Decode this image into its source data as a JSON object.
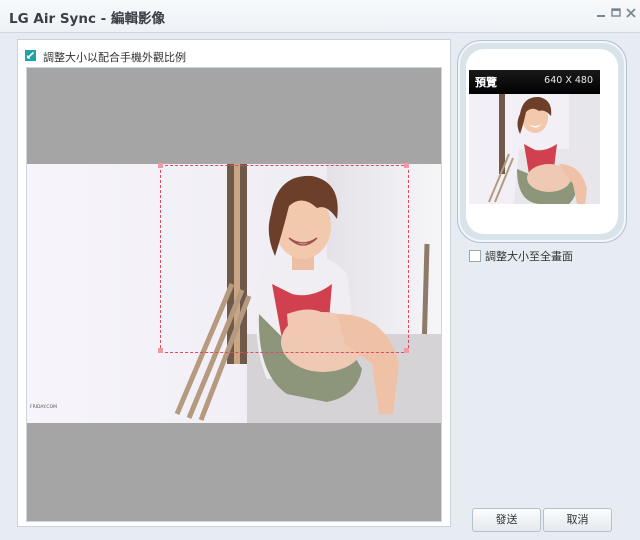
{
  "window": {
    "title": "LG Air Sync - 編輯影像"
  },
  "editor": {
    "keep_ratio_label": "調整大小以配合手機外觀比例",
    "keep_ratio_checked": true,
    "photo_watermark": "FRIDAY.COM"
  },
  "preview": {
    "title": "預覽",
    "resolution": "640 X 480"
  },
  "fit_screen": {
    "label": "調整大小至全畫面",
    "checked": false
  },
  "buttons": {
    "send": "發送",
    "cancel": "取消"
  }
}
